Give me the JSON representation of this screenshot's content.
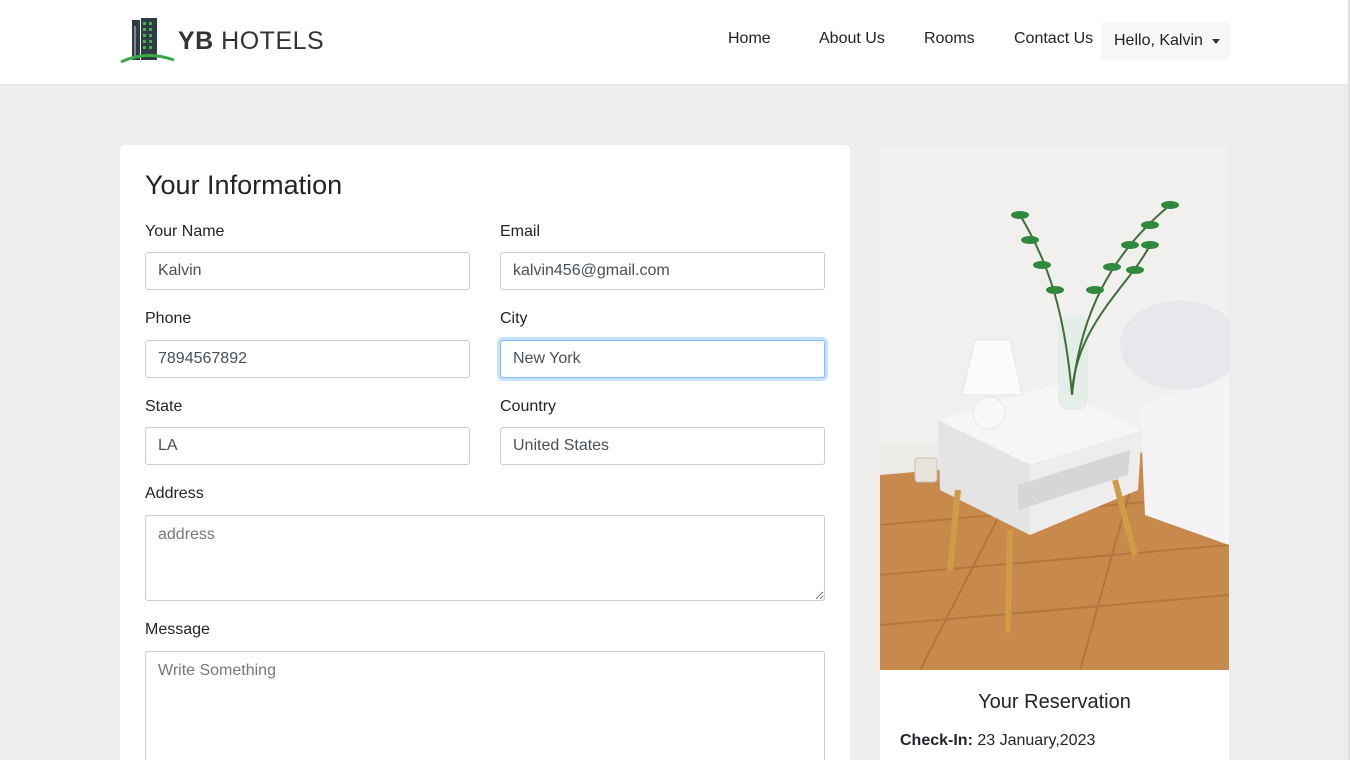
{
  "brand": {
    "bold": "YB",
    "rest": " HOTELS"
  },
  "nav": {
    "links": [
      "Home",
      "About Us",
      "Rooms",
      "Contact Us"
    ],
    "user": "Hello, Kalvin"
  },
  "form": {
    "title": "Your Information",
    "name": {
      "label": "Your Name",
      "value": "Kalvin"
    },
    "email": {
      "label": "Email",
      "value": "kalvin456@gmail.com"
    },
    "phone": {
      "label": "Phone",
      "value": "7894567892"
    },
    "city": {
      "label": "City",
      "value": "New York"
    },
    "state": {
      "label": "State",
      "value": "LA"
    },
    "country": {
      "label": "Country",
      "value": "United States"
    },
    "address": {
      "label": "Address",
      "placeholder": "address"
    },
    "message": {
      "label": "Message",
      "placeholder": "Write Something"
    }
  },
  "reservation": {
    "title": "Your Reservation",
    "checkin_label": "Check-In:",
    "checkin_value": " 23 January,2023"
  },
  "colors": {
    "accent_focus": "#80bdff",
    "logo_green": "#3aa845",
    "background": "#ededed"
  }
}
